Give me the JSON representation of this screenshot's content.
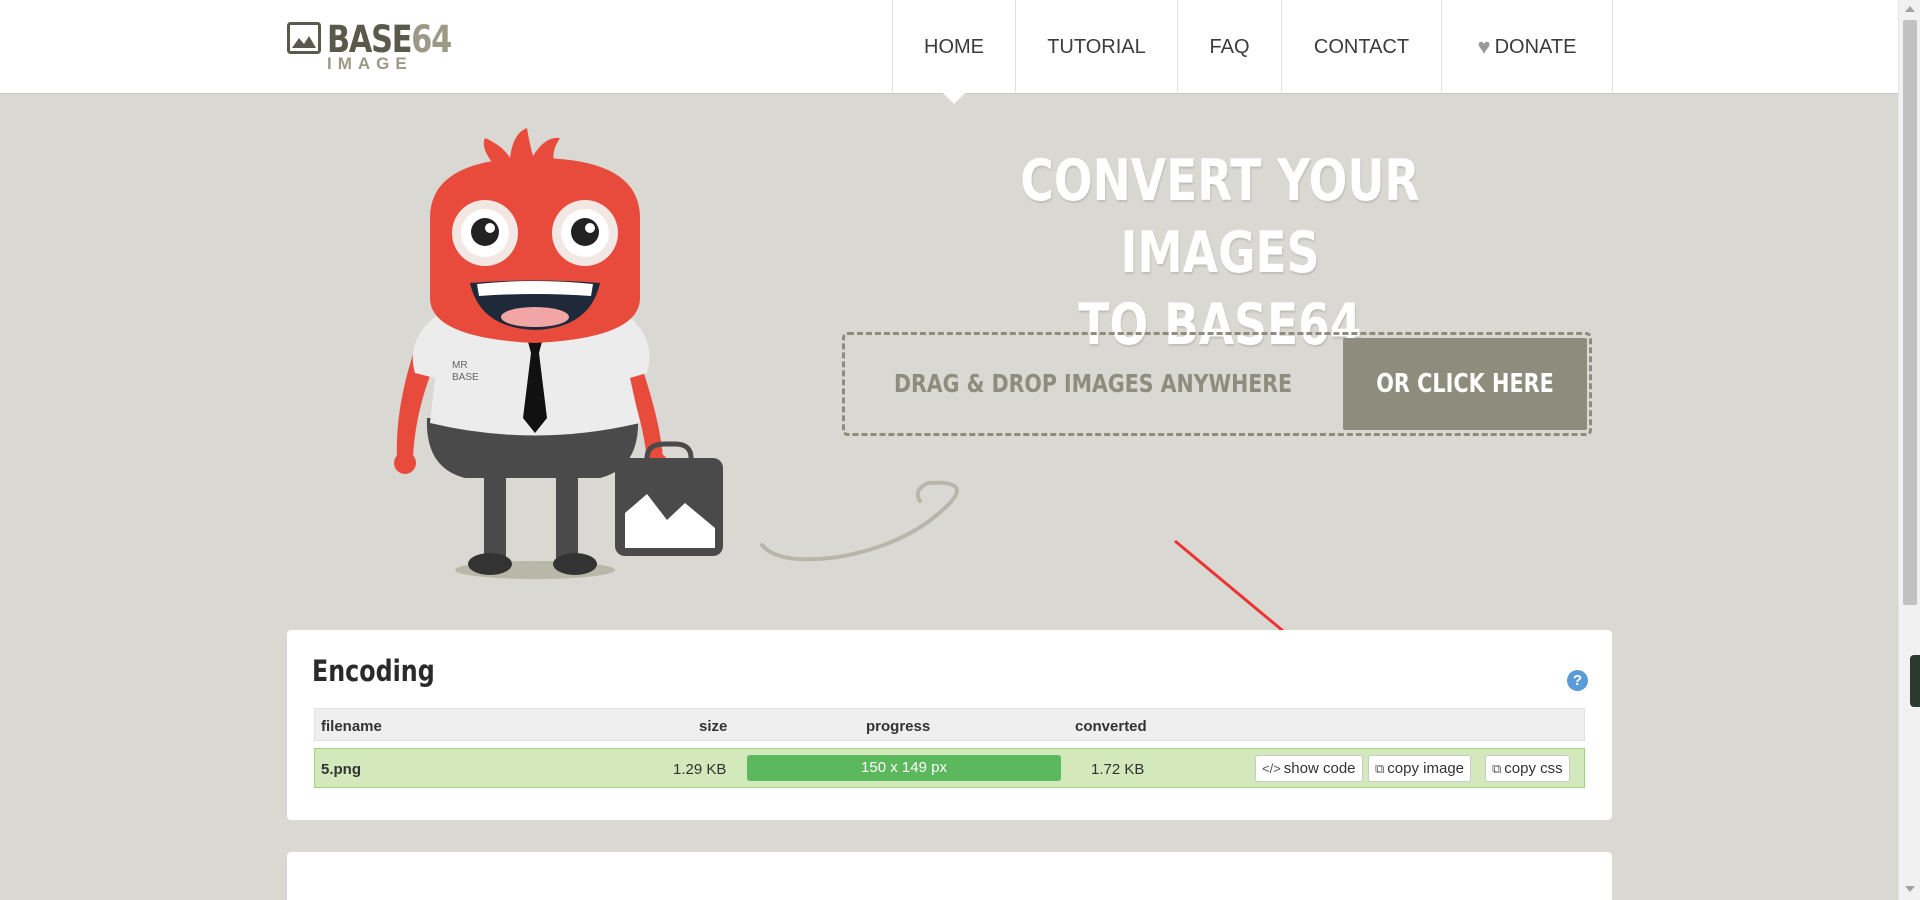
{
  "header": {
    "logo_title_main": "BASE",
    "logo_title_num": "64",
    "logo_subtitle": "IMAGE",
    "nav": [
      {
        "label": "HOME",
        "active": true
      },
      {
        "label": "TUTORIAL"
      },
      {
        "label": "FAQ"
      },
      {
        "label": "CONTACT"
      },
      {
        "label": "DONATE",
        "icon": "heart-icon"
      }
    ]
  },
  "hero": {
    "title_line1": "CONVERT YOUR IMAGES",
    "title_line2": "TO BASE64",
    "drop_text": "DRAG & DROP IMAGES ANYWHERE",
    "click_button": "OR CLICK HERE",
    "mascot_shirt_text_1": "MR",
    "mascot_shirt_text_2": "BASE"
  },
  "encoding": {
    "title": "Encoding",
    "help_icon": "?",
    "columns": {
      "filename": "filename",
      "size": "size",
      "progress": "progress",
      "converted": "converted"
    },
    "row": {
      "filename": "5.png",
      "size": "1.29 KB",
      "progress_label": "150 x 149 px",
      "progress_value": 1.0,
      "converted": "1.72 KB",
      "show_code": "show code",
      "copy_image": "copy image",
      "copy_css": "copy css"
    }
  },
  "colors": {
    "background": "#d9d8d2",
    "accent_olive": "#8e8c7c",
    "mascot_red": "#e84b3c",
    "progress_green": "#5cb85c",
    "row_green": "#d3e8bb",
    "annotation_arrow": "#ee3333"
  }
}
